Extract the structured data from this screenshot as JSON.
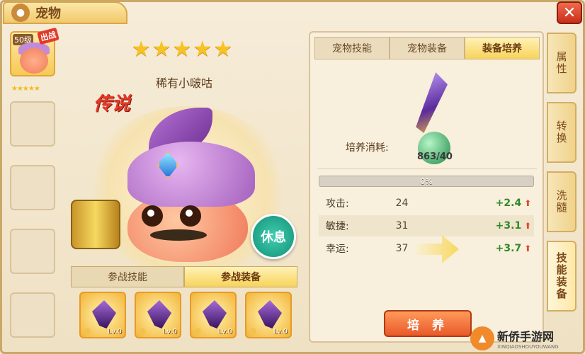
{
  "window": {
    "title": "宠物",
    "close_label": "✕"
  },
  "pet_list": {
    "active": {
      "level": "50级",
      "badge": "出战",
      "stars": "★★★★★"
    },
    "empty_slots": 4
  },
  "pet": {
    "stars": "★★★★★",
    "name": "稀有小啵咕",
    "rarity": "传说",
    "rest_button": "休息"
  },
  "lower_tabs": [
    {
      "label": "参战技能",
      "selected": false
    },
    {
      "label": "参战装备",
      "selected": true
    }
  ],
  "equipment": [
    {
      "level": "Lv.0"
    },
    {
      "level": "Lv.0"
    },
    {
      "level": "Lv.0"
    },
    {
      "level": "Lv.0"
    }
  ],
  "right_panel": {
    "tabs": [
      {
        "label": "宠物技能",
        "selected": false
      },
      {
        "label": "宠物装备",
        "selected": false
      },
      {
        "label": "装备培养",
        "selected": true
      }
    ],
    "cost_label": "培养消耗:",
    "cost_value": "863/40",
    "progress_text": "0%",
    "progress_fraction": 0,
    "stats": [
      {
        "name": "攻击:",
        "value": "24",
        "gain": "+2.4"
      },
      {
        "name": "敏捷:",
        "value": "31",
        "gain": "+3.1"
      },
      {
        "name": "幸运:",
        "value": "37",
        "gain": "+3.7"
      }
    ],
    "train_button": "培 养"
  },
  "side_tabs": [
    {
      "label": "属性",
      "selected": false
    },
    {
      "label": "转换",
      "selected": false
    },
    {
      "label": "洗髓",
      "selected": false
    },
    {
      "label": "技能装备",
      "selected": true
    }
  ],
  "watermark": {
    "text": "新侨手游网",
    "sub": "XINQIAOSHOUYOUWANG"
  }
}
